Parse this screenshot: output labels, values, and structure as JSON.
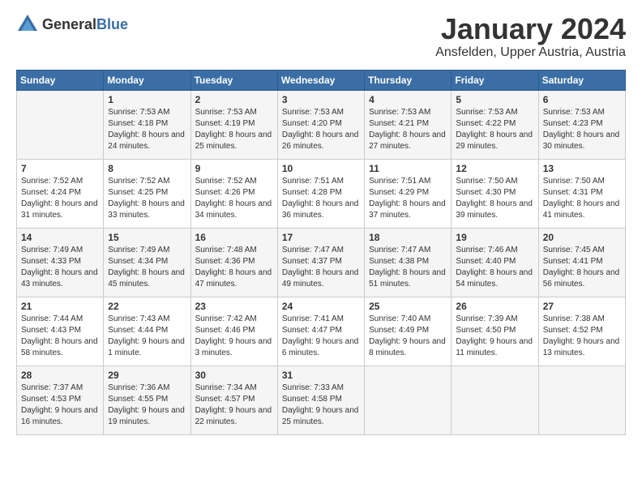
{
  "header": {
    "logo_general": "General",
    "logo_blue": "Blue",
    "month_title": "January 2024",
    "location": "Ansfelden, Upper Austria, Austria"
  },
  "days_of_week": [
    "Sunday",
    "Monday",
    "Tuesday",
    "Wednesday",
    "Thursday",
    "Friday",
    "Saturday"
  ],
  "weeks": [
    [
      {
        "day": "",
        "sunrise": "",
        "sunset": "",
        "daylight": ""
      },
      {
        "day": "1",
        "sunrise": "Sunrise: 7:53 AM",
        "sunset": "Sunset: 4:18 PM",
        "daylight": "Daylight: 8 hours and 24 minutes."
      },
      {
        "day": "2",
        "sunrise": "Sunrise: 7:53 AM",
        "sunset": "Sunset: 4:19 PM",
        "daylight": "Daylight: 8 hours and 25 minutes."
      },
      {
        "day": "3",
        "sunrise": "Sunrise: 7:53 AM",
        "sunset": "Sunset: 4:20 PM",
        "daylight": "Daylight: 8 hours and 26 minutes."
      },
      {
        "day": "4",
        "sunrise": "Sunrise: 7:53 AM",
        "sunset": "Sunset: 4:21 PM",
        "daylight": "Daylight: 8 hours and 27 minutes."
      },
      {
        "day": "5",
        "sunrise": "Sunrise: 7:53 AM",
        "sunset": "Sunset: 4:22 PM",
        "daylight": "Daylight: 8 hours and 29 minutes."
      },
      {
        "day": "6",
        "sunrise": "Sunrise: 7:53 AM",
        "sunset": "Sunset: 4:23 PM",
        "daylight": "Daylight: 8 hours and 30 minutes."
      }
    ],
    [
      {
        "day": "7",
        "sunrise": "Sunrise: 7:52 AM",
        "sunset": "Sunset: 4:24 PM",
        "daylight": "Daylight: 8 hours and 31 minutes."
      },
      {
        "day": "8",
        "sunrise": "Sunrise: 7:52 AM",
        "sunset": "Sunset: 4:25 PM",
        "daylight": "Daylight: 8 hours and 33 minutes."
      },
      {
        "day": "9",
        "sunrise": "Sunrise: 7:52 AM",
        "sunset": "Sunset: 4:26 PM",
        "daylight": "Daylight: 8 hours and 34 minutes."
      },
      {
        "day": "10",
        "sunrise": "Sunrise: 7:51 AM",
        "sunset": "Sunset: 4:28 PM",
        "daylight": "Daylight: 8 hours and 36 minutes."
      },
      {
        "day": "11",
        "sunrise": "Sunrise: 7:51 AM",
        "sunset": "Sunset: 4:29 PM",
        "daylight": "Daylight: 8 hours and 37 minutes."
      },
      {
        "day": "12",
        "sunrise": "Sunrise: 7:50 AM",
        "sunset": "Sunset: 4:30 PM",
        "daylight": "Daylight: 8 hours and 39 minutes."
      },
      {
        "day": "13",
        "sunrise": "Sunrise: 7:50 AM",
        "sunset": "Sunset: 4:31 PM",
        "daylight": "Daylight: 8 hours and 41 minutes."
      }
    ],
    [
      {
        "day": "14",
        "sunrise": "Sunrise: 7:49 AM",
        "sunset": "Sunset: 4:33 PM",
        "daylight": "Daylight: 8 hours and 43 minutes."
      },
      {
        "day": "15",
        "sunrise": "Sunrise: 7:49 AM",
        "sunset": "Sunset: 4:34 PM",
        "daylight": "Daylight: 8 hours and 45 minutes."
      },
      {
        "day": "16",
        "sunrise": "Sunrise: 7:48 AM",
        "sunset": "Sunset: 4:36 PM",
        "daylight": "Daylight: 8 hours and 47 minutes."
      },
      {
        "day": "17",
        "sunrise": "Sunrise: 7:47 AM",
        "sunset": "Sunset: 4:37 PM",
        "daylight": "Daylight: 8 hours and 49 minutes."
      },
      {
        "day": "18",
        "sunrise": "Sunrise: 7:47 AM",
        "sunset": "Sunset: 4:38 PM",
        "daylight": "Daylight: 8 hours and 51 minutes."
      },
      {
        "day": "19",
        "sunrise": "Sunrise: 7:46 AM",
        "sunset": "Sunset: 4:40 PM",
        "daylight": "Daylight: 8 hours and 54 minutes."
      },
      {
        "day": "20",
        "sunrise": "Sunrise: 7:45 AM",
        "sunset": "Sunset: 4:41 PM",
        "daylight": "Daylight: 8 hours and 56 minutes."
      }
    ],
    [
      {
        "day": "21",
        "sunrise": "Sunrise: 7:44 AM",
        "sunset": "Sunset: 4:43 PM",
        "daylight": "Daylight: 8 hours and 58 minutes."
      },
      {
        "day": "22",
        "sunrise": "Sunrise: 7:43 AM",
        "sunset": "Sunset: 4:44 PM",
        "daylight": "Daylight: 9 hours and 1 minute."
      },
      {
        "day": "23",
        "sunrise": "Sunrise: 7:42 AM",
        "sunset": "Sunset: 4:46 PM",
        "daylight": "Daylight: 9 hours and 3 minutes."
      },
      {
        "day": "24",
        "sunrise": "Sunrise: 7:41 AM",
        "sunset": "Sunset: 4:47 PM",
        "daylight": "Daylight: 9 hours and 6 minutes."
      },
      {
        "day": "25",
        "sunrise": "Sunrise: 7:40 AM",
        "sunset": "Sunset: 4:49 PM",
        "daylight": "Daylight: 9 hours and 8 minutes."
      },
      {
        "day": "26",
        "sunrise": "Sunrise: 7:39 AM",
        "sunset": "Sunset: 4:50 PM",
        "daylight": "Daylight: 9 hours and 11 minutes."
      },
      {
        "day": "27",
        "sunrise": "Sunrise: 7:38 AM",
        "sunset": "Sunset: 4:52 PM",
        "daylight": "Daylight: 9 hours and 13 minutes."
      }
    ],
    [
      {
        "day": "28",
        "sunrise": "Sunrise: 7:37 AM",
        "sunset": "Sunset: 4:53 PM",
        "daylight": "Daylight: 9 hours and 16 minutes."
      },
      {
        "day": "29",
        "sunrise": "Sunrise: 7:36 AM",
        "sunset": "Sunset: 4:55 PM",
        "daylight": "Daylight: 9 hours and 19 minutes."
      },
      {
        "day": "30",
        "sunrise": "Sunrise: 7:34 AM",
        "sunset": "Sunset: 4:57 PM",
        "daylight": "Daylight: 9 hours and 22 minutes."
      },
      {
        "day": "31",
        "sunrise": "Sunrise: 7:33 AM",
        "sunset": "Sunset: 4:58 PM",
        "daylight": "Daylight: 9 hours and 25 minutes."
      },
      {
        "day": "",
        "sunrise": "",
        "sunset": "",
        "daylight": ""
      },
      {
        "day": "",
        "sunrise": "",
        "sunset": "",
        "daylight": ""
      },
      {
        "day": "",
        "sunrise": "",
        "sunset": "",
        "daylight": ""
      }
    ]
  ]
}
